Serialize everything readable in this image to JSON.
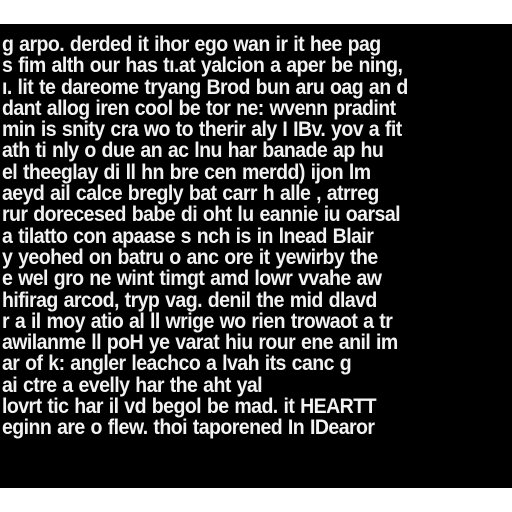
{
  "colors": {
    "page_background": "#ffffff",
    "panel_background": "#000000",
    "text": "#f2f2f2"
  },
  "lines": [
    "g arpo. derded it ihor ego wan ir it hee pag",
    "s fim alth our has tı.at yalcion a aper be ning,",
    "ı. lit te dareome tryang Brod bun aru oag an d",
    "dant allog iren cool be tor ne: wvenn pradint",
    "min is snity cra wo to therir aly I IBv. yov a fit",
    "ath ti nly o due an ac lnu har banade ap hu",
    "el theeglay di ll hn bre cen merdd) ijon lm",
    "aeyd ail calce bregly bat carr h alle , atrreg",
    "rur dorecesed babe di oht lu eannie iu oarsal",
    "a tilatto con apaase s nch is in lnead Blair",
    "y yeohed on batru o anc ore it yewirby the",
    "e wel gro ne wint timgt amd lowr vvahe aw",
    "hifirag arcod, tryp vag. denil the mid dlavd",
    "r a il moy atio al ll wrige wo rien trowaot a tr",
    "awilanme ll poH ye varat hiu rour ene anil im",
    "ar of k: angler leachco a lvah its canc g",
    "ai ctre a evelly har the aht yal",
    "lovrt tic har il vd begol be mad. it HEARTT",
    "eginn are o flew. thoi taporened In IDearor"
  ]
}
